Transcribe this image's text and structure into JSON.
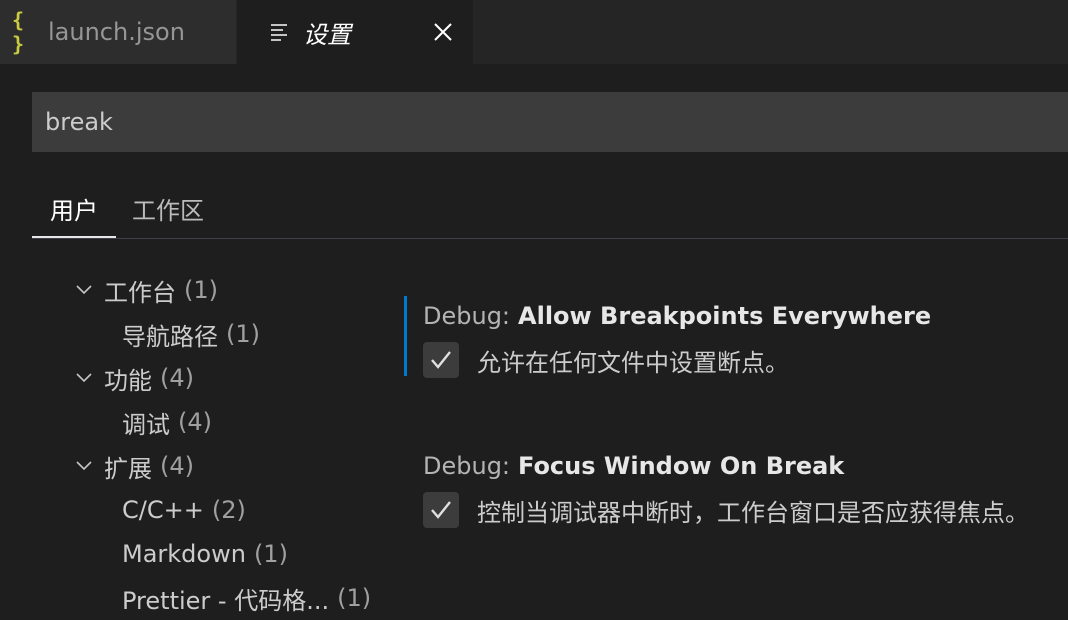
{
  "tabs": [
    {
      "label": "launch.json",
      "icon": "json-icon"
    },
    {
      "label": "设置",
      "icon": "settings-lines-icon"
    }
  ],
  "search": {
    "value": "break"
  },
  "scope_tabs": [
    {
      "label": "用户",
      "active": true
    },
    {
      "label": "工作区",
      "active": false
    }
  ],
  "toc": [
    {
      "label": "工作台",
      "count": "(1)",
      "expanded": true
    },
    {
      "label": "导航路径",
      "count": "(1)"
    },
    {
      "label": "功能",
      "count": "(4)",
      "expanded": true
    },
    {
      "label": "调试",
      "count": "(4)"
    },
    {
      "label": "扩展",
      "count": "(4)",
      "expanded": true
    },
    {
      "label": "C/C++",
      "count": "(2)"
    },
    {
      "label": "Markdown",
      "count": "(1)"
    },
    {
      "label": "Prettier - 代码格...",
      "count": "(1)"
    }
  ],
  "settings": [
    {
      "category": "Debug:",
      "name": "Allow Breakpoints Everywhere",
      "description": "允许在任何文件中设置断点。",
      "checked": true
    },
    {
      "category": "Debug:",
      "name": "Focus Window On Break",
      "description": "控制当调试器中断时，工作台窗口是否应获得焦点。",
      "checked": true
    }
  ],
  "colors": {
    "accent": "#007acc",
    "json_icon": "#cbcb41",
    "background": "#1e1e1e"
  }
}
